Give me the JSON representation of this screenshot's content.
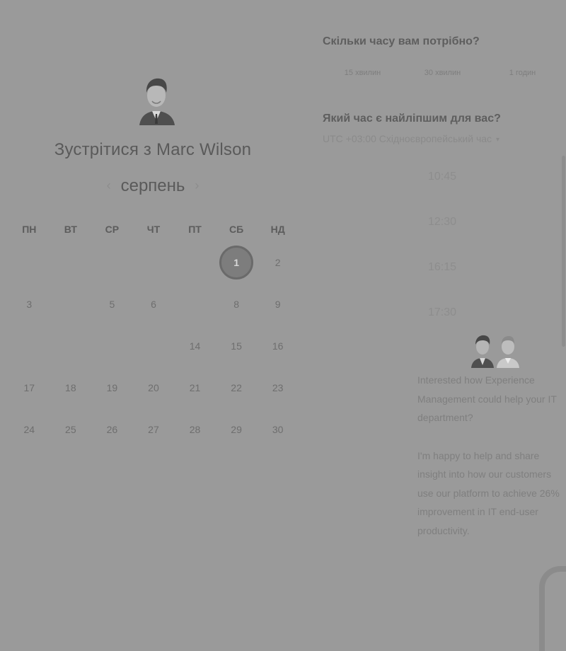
{
  "meeting": {
    "title": "Зустрітися з Marc Wilson"
  },
  "calendar": {
    "month": "серпень",
    "prev_icon": "‹",
    "next_icon": "›",
    "weekdays": [
      "ПН",
      "ВТ",
      "СР",
      "ЧТ",
      "ПТ",
      "СБ",
      "НД"
    ],
    "weeks": [
      [
        "",
        "",
        "",
        "",
        "",
        "1",
        "2"
      ],
      [
        "3",
        "",
        "5",
        "6",
        "",
        "8",
        "9"
      ],
      [
        "",
        "",
        "",
        "",
        "14",
        "15",
        "16"
      ],
      [
        "17",
        "18",
        "19",
        "20",
        "21",
        "22",
        "23"
      ],
      [
        "24",
        "25",
        "26",
        "27",
        "28",
        "29",
        "30"
      ],
      [
        "",
        "",
        "",
        "",
        "",
        "",
        ""
      ]
    ],
    "selected_day": "1"
  },
  "duration": {
    "question": "Скільки часу вам потрібно?",
    "options": [
      "15 хвилин",
      "30 хвилин",
      "1 годин"
    ]
  },
  "time": {
    "question": "Який час є найліпшим для вас?",
    "timezone": "UTC +03:00 Східноєвропейський час",
    "timezone_caret": "▾",
    "slots": [
      "10:45",
      "12:30",
      "16:15",
      "17:30"
    ]
  },
  "pitch": {
    "paragraph1": "Interested how Experience Management could help your IT department?",
    "paragraph2": "I'm happy to help and share insight into how our customers use our platform to achieve 26% improvement in IT end-user productivity."
  },
  "colors": {
    "background": "#9a9a9a",
    "selected_day": "#7d7d7d"
  }
}
